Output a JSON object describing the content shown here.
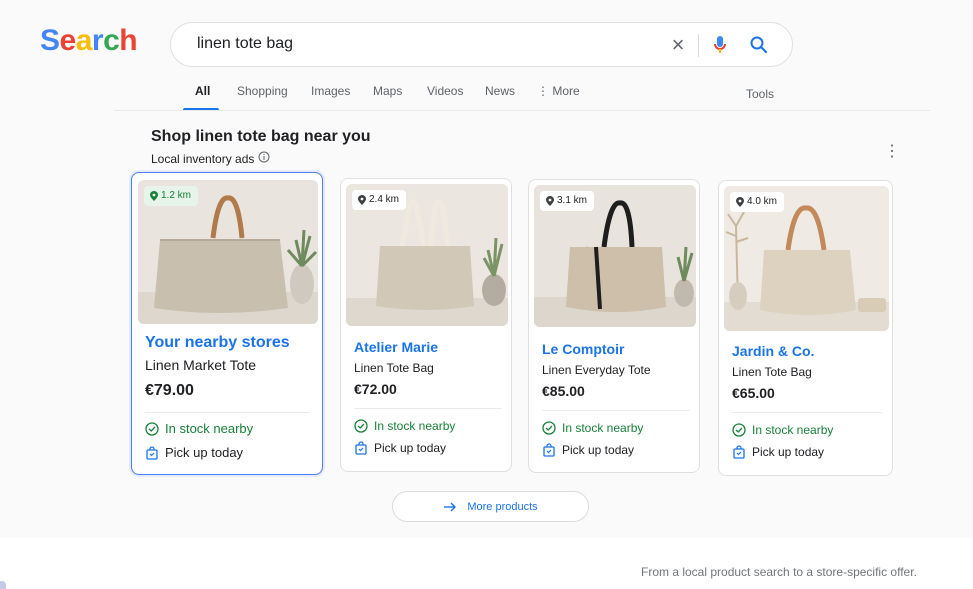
{
  "logo": {
    "letters": [
      "S",
      "e",
      "a",
      "r",
      "c",
      "h"
    ],
    "colors": [
      "#4285F4",
      "#EA4335",
      "#FBBC05",
      "#4285F4",
      "#34A853",
      "#EA4335"
    ]
  },
  "search": {
    "query": "linen tote bag"
  },
  "tabs": [
    {
      "label": "All",
      "active": true
    },
    {
      "label": "Shopping"
    },
    {
      "label": "Images"
    },
    {
      "label": "Maps"
    },
    {
      "label": "Videos"
    },
    {
      "label": "News"
    },
    {
      "label": "More"
    }
  ],
  "tools_label": "Tools",
  "section": {
    "title": "Shop linen tote bag near you",
    "subtitle": "Local inventory ads"
  },
  "cards": [
    {
      "distance": "1.2 km",
      "store": "Your nearby stores",
      "product": "Linen Market Tote",
      "price": "€79.00",
      "stock": "In stock nearby",
      "pickup": "Pick up today",
      "strap_color": "#b07a4a"
    },
    {
      "distance": "2.4 km",
      "store": "Atelier Marie",
      "product": "Linen Tote Bag",
      "price": "€72.00",
      "stock": "In stock nearby",
      "pickup": "Pick up today",
      "strap_color": "#efe9df"
    },
    {
      "distance": "3.1 km",
      "store": "Le Comptoir",
      "product": "Linen Everyday Tote",
      "price": "€85.00",
      "stock": "In stock nearby",
      "pickup": "Pick up today",
      "strap_color": "#1e1e1e"
    },
    {
      "distance": "4.0 km",
      "store": "Jardin & Co.",
      "product": "Linen Tote Bag",
      "price": "€65.00",
      "stock": "In stock nearby",
      "pickup": "Pick up today",
      "strap_color": "#c4895a"
    }
  ],
  "more_products_label": "More products",
  "caption": "From a local product search to a store-specific offer.",
  "colors": {
    "accent": "#1a73e8",
    "stock_green": "#188038",
    "selected_border": "#4c7ff0"
  }
}
